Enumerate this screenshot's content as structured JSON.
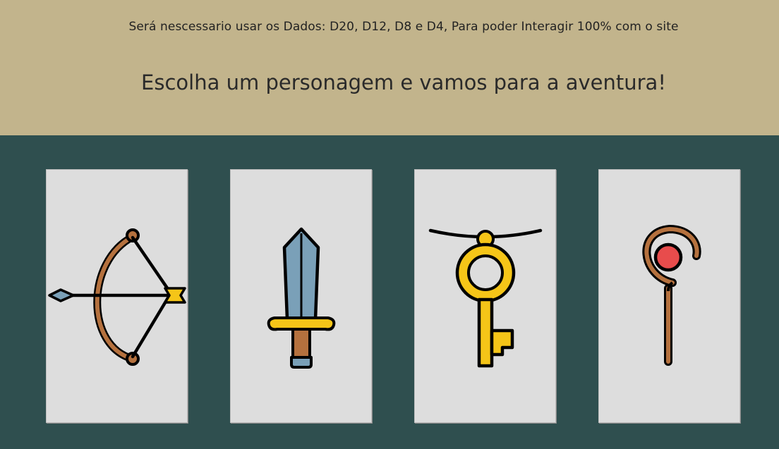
{
  "header": {
    "notice": "Será nescessario usar os Dados: D20, D12, D8 e D4, Para poder Interagir 100% com o site",
    "title": "Escolha um personagem e vamos para a aventura!"
  },
  "colors": {
    "header_bg": "#c2b48c",
    "main_bg": "#2f4f4f",
    "card_bg": "#dddddd",
    "wood": "#b5713e",
    "steel": "#7aa0b8",
    "gold": "#f5c518",
    "gem": "#e84c4c"
  },
  "characters": [
    {
      "icon": "bow-and-arrow-icon"
    },
    {
      "icon": "sword-icon"
    },
    {
      "icon": "key-pendant-icon"
    },
    {
      "icon": "staff-icon"
    }
  ]
}
